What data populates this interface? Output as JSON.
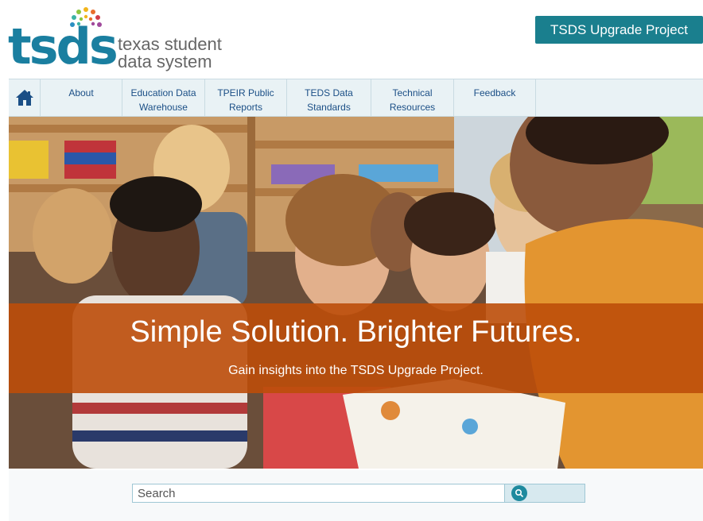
{
  "logo": {
    "wordmark": "tsds",
    "tagline_line1": "texas student",
    "tagline_line2": "data system"
  },
  "header": {
    "upgrade_button": "TSDS Upgrade Project"
  },
  "nav": {
    "home_icon": "home-icon",
    "items": [
      {
        "line1": "About",
        "line2": ""
      },
      {
        "line1": "Education Data",
        "line2": "Warehouse"
      },
      {
        "line1": "TPEIR Public",
        "line2": "Reports"
      },
      {
        "line1": "TEDS Data",
        "line2": "Standards"
      },
      {
        "line1": "Technical",
        "line2": "Resources"
      },
      {
        "line1": "Feedback",
        "line2": ""
      }
    ]
  },
  "hero": {
    "title": "Simple Solution. Brighter Futures.",
    "subtitle": "Gain insights into the TSDS Upgrade Project."
  },
  "search": {
    "placeholder": "Search",
    "button_icon": "search-icon"
  },
  "colors": {
    "brand_blue": "#1a7fa0",
    "button_teal": "#1a7f8e",
    "banner_orange": "#bc4e0a",
    "nav_bg": "#e9f2f5",
    "nav_text": "#1b4f86"
  }
}
